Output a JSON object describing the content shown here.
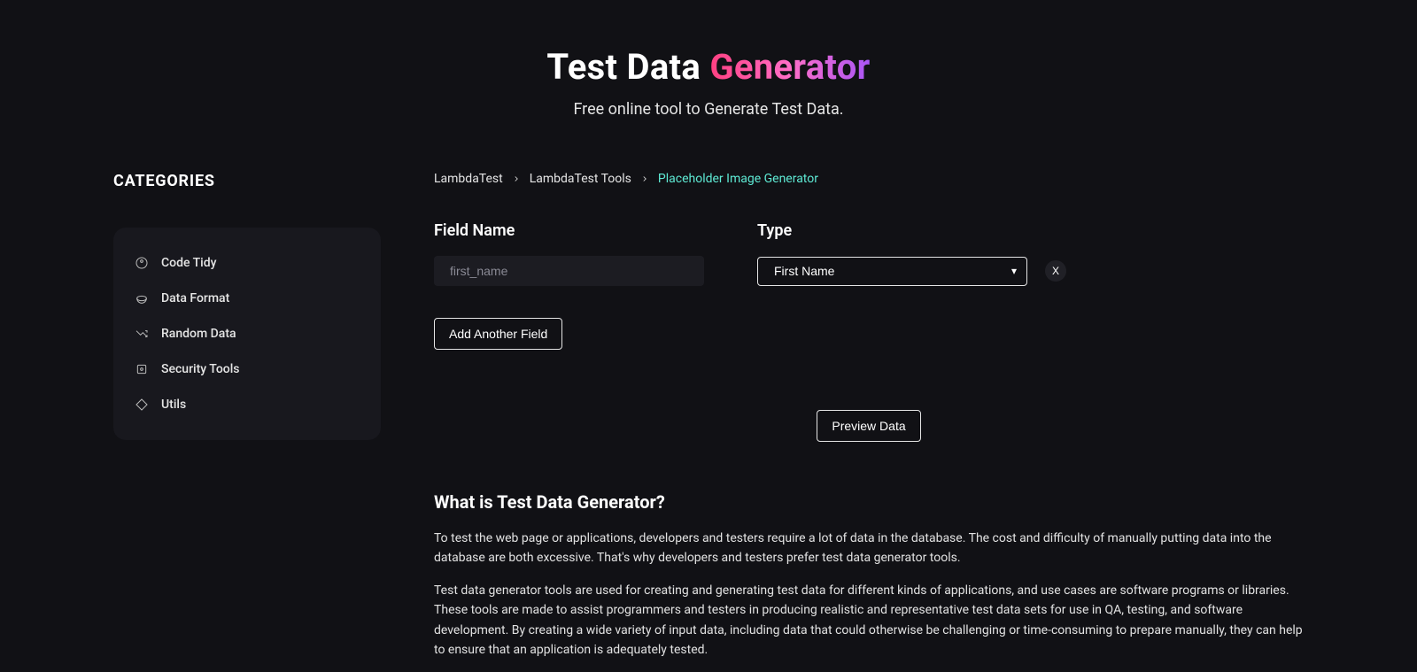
{
  "hero": {
    "title_prefix": "Test Data ",
    "title_highlight": "Generator",
    "subtitle": "Free online tool to Generate Test Data."
  },
  "sidebar": {
    "title": "CATEGORIES",
    "items": [
      {
        "label": "Code Tidy"
      },
      {
        "label": "Data Format"
      },
      {
        "label": "Random Data"
      },
      {
        "label": "Security Tools"
      },
      {
        "label": "Utils"
      }
    ]
  },
  "breadcrumb": {
    "items": [
      {
        "label": "LambdaTest"
      },
      {
        "label": "LambdaTest Tools"
      },
      {
        "label": "Placeholder Image Generator"
      }
    ]
  },
  "form": {
    "field_name_label": "Field Name",
    "type_label": "Type",
    "field_name_placeholder": "first_name",
    "field_name_value": "",
    "type_selected": "First Name",
    "remove_label": "X",
    "add_button": "Add Another Field",
    "preview_button": "Preview Data"
  },
  "article": {
    "heading": "What is Test Data Generator?",
    "p1": "To test the web page or applications, developers and testers require a lot of data in the database. The cost and difficulty of manually putting data into the database are both excessive. That's why developers and testers prefer test data generator tools.",
    "p2": "Test data generator tools are used for creating and generating test data for different kinds of applications, and use cases are software programs or libraries. These tools are made to assist programmers and testers in producing realistic and representative test data sets for use in QA, testing, and software development. By creating a wide variety of input data, including data that could otherwise be challenging or time-consuming to prepare manually, they can help to ensure that an application is adequately tested."
  }
}
